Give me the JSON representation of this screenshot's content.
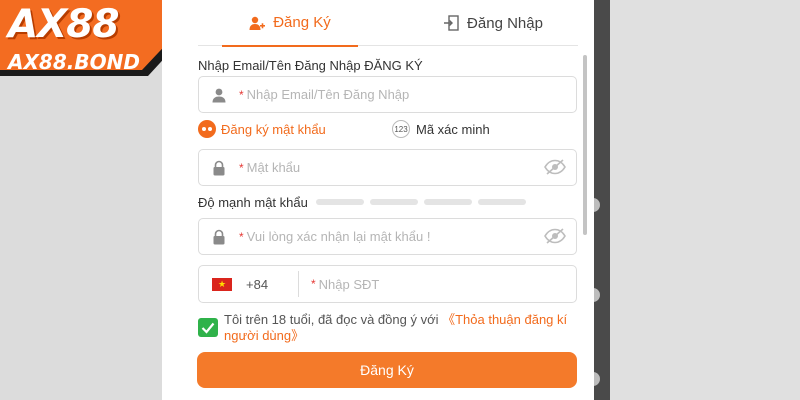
{
  "logo": {
    "main": "AX88",
    "sub": "AX88.BOND"
  },
  "tabs": {
    "register": {
      "label": "Đăng Ký",
      "icon": "user-plus-icon"
    },
    "login": {
      "label": "Đăng Nhập",
      "icon": "login-door-icon"
    }
  },
  "form": {
    "email_label": "Nhập Email/Tên Đăng Nhập ĐĂNG KÝ",
    "email_placeholder": "Nhập Email/Tên Đăng Nhập",
    "required_mark": "*",
    "mode_password": "Đăng ký mật khẩu",
    "mode_otp": "Mã xác minh",
    "otp_badge": "123",
    "password_placeholder": "Mật khẩu",
    "strength_label": "Độ mạnh mật khẩu",
    "strength_level": 0,
    "confirm_placeholder": "Vui lòng xác nhận lại mật khẩu !",
    "phone_code": "+84",
    "phone_placeholder": "Nhập SĐT",
    "agree_text": "Tôi trên 18 tuổi, đã đọc và đồng ý với ",
    "agree_link": "《Thỏa thuận đăng kí người dùng》",
    "agree_checked": true,
    "submit_label": "Đăng Ký"
  },
  "colors": {
    "accent": "#f26b1d",
    "button": "#f47a2a",
    "checkbox": "#2fb24a"
  }
}
